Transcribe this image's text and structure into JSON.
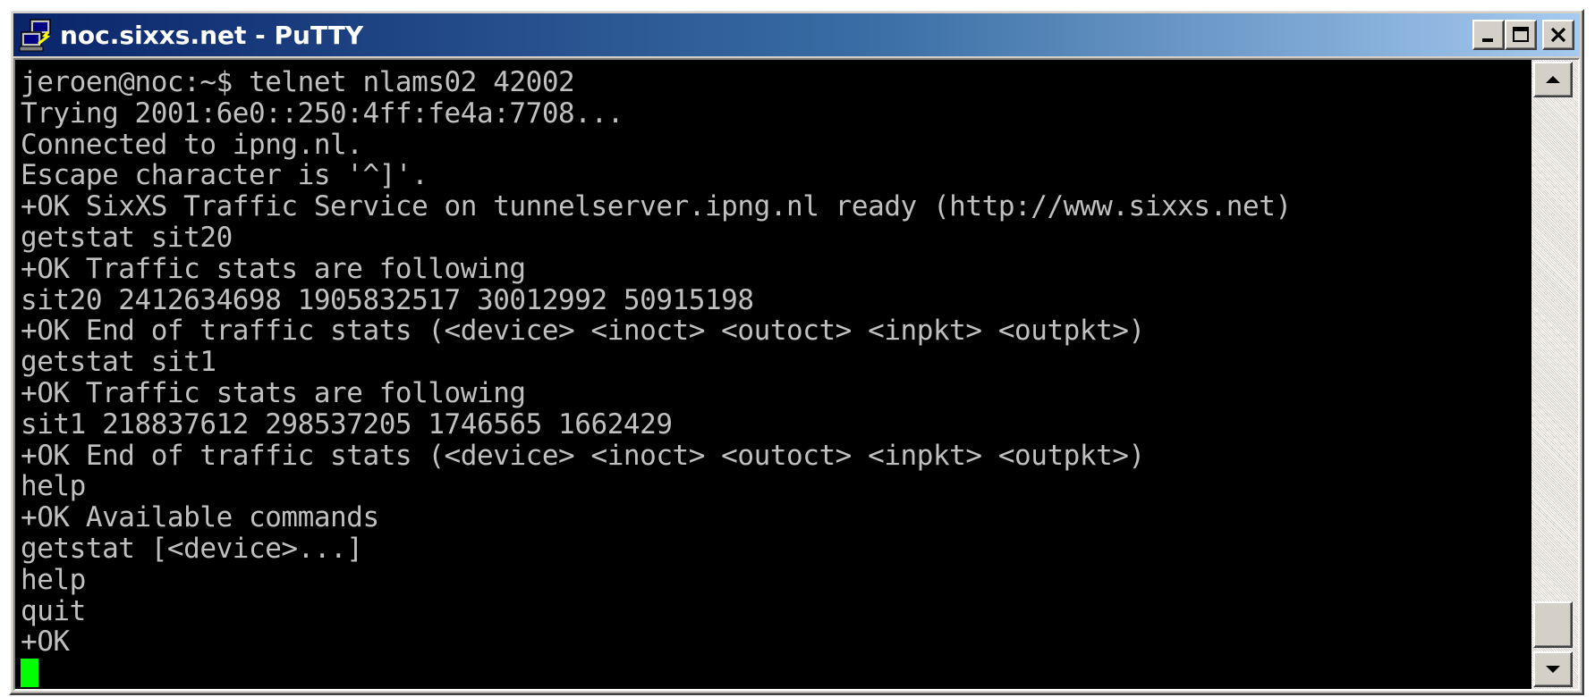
{
  "window": {
    "title": "noc.sixxs.net - PuTTY",
    "icon": "putty-terminal-icon",
    "buttons": {
      "minimize": "minimize-icon",
      "maximize": "maximize-icon",
      "close": "close-icon"
    }
  },
  "terminal": {
    "foreground": "#c0c0c0",
    "background": "#000000",
    "cursor_color": "#00ff00",
    "lines": [
      "jeroen@noc:~$ telnet nlams02 42002",
      "Trying 2001:6e0::250:4ff:fe4a:7708...",
      "Connected to ipng.nl.",
      "Escape character is '^]'.",
      "+OK SixXS Traffic Service on tunnelserver.ipng.nl ready (http://www.sixxs.net)",
      "getstat sit20",
      "+OK Traffic stats are following",
      "sit20 2412634698 1905832517 30012992 50915198",
      "+OK End of traffic stats (<device> <inoct> <outoct> <inpkt> <outpkt>)",
      "getstat sit1",
      "+OK Traffic stats are following",
      "sit1 218837612 298537205 1746565 1662429",
      "+OK End of traffic stats (<device> <inoct> <outoct> <inpkt> <outpkt>)",
      "help",
      "+OK Available commands",
      "getstat [<device>...]",
      "help",
      "quit",
      "+OK"
    ]
  },
  "scrollbar": {
    "up_icon": "scroll-up-arrow-icon",
    "down_icon": "scroll-down-arrow-icon",
    "position": 1.0
  }
}
